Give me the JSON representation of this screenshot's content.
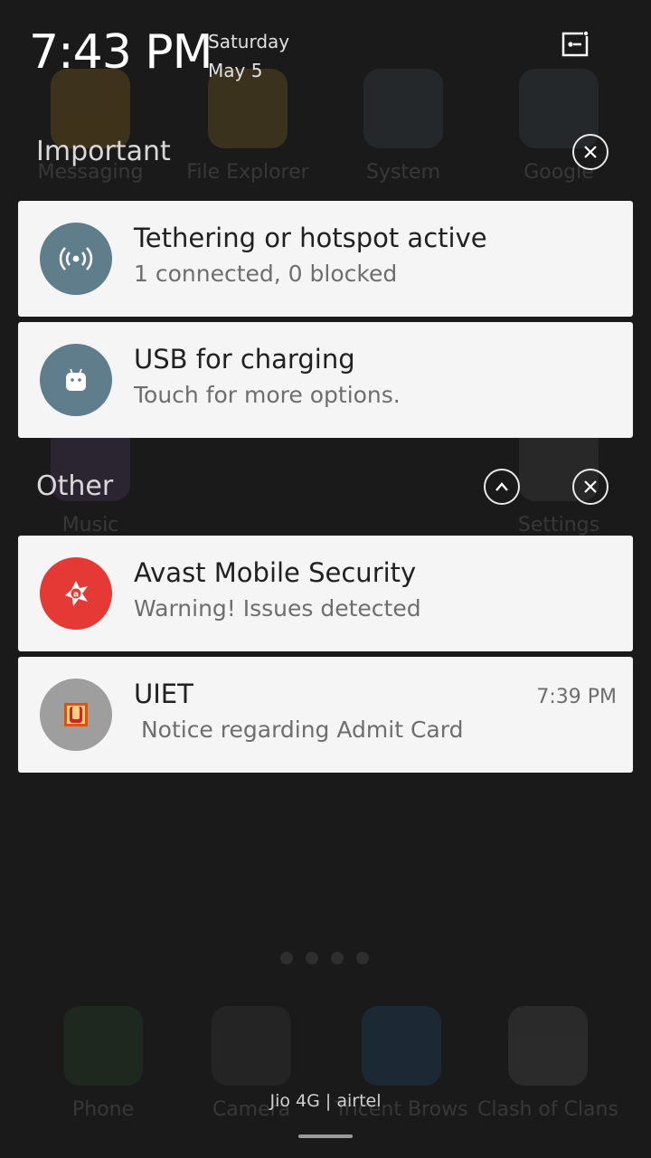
{
  "status": {
    "time": "7:43 PM",
    "day": "Saturday",
    "date": "May 5",
    "edit_icon": "edit-notifications-icon"
  },
  "background_apps": [
    {
      "label": "Messaging",
      "color": "#e0a020"
    },
    {
      "label": "File Explorer",
      "color": "#d0a030"
    },
    {
      "label": "System",
      "color": "#5a6a7a"
    },
    {
      "label": "Google",
      "color": "#5a6a7a"
    },
    {
      "label": "Music",
      "color": "#7a5aa0"
    },
    {
      "label": "Settings",
      "color": "#6a6a6a"
    },
    {
      "label": "Phone",
      "color": "#3a6a3a"
    },
    {
      "label": "Camera",
      "color": "#555555"
    },
    {
      "label": "Tricent Brows",
      "color": "#2a6aaa"
    },
    {
      "label": "Clash of Clans",
      "color": "#777777"
    }
  ],
  "sections": {
    "important": {
      "title": "Important"
    },
    "other": {
      "title": "Other"
    }
  },
  "notifications": [
    {
      "title": "Tethering or hotspot active",
      "subtitle": "1 connected, 0 blocked",
      "icon": "hotspot-icon",
      "color": "#607d8b"
    },
    {
      "title": "USB for charging",
      "subtitle": "Touch for more options.",
      "icon": "android-usb-icon",
      "color": "#607d8b"
    },
    {
      "title": "Avast Mobile Security",
      "subtitle": "Warning! Issues detected",
      "icon": "avast-icon",
      "color": "#e53935"
    },
    {
      "title": "UIET",
      "subtitle": " Notice regarding Admit Card",
      "time": "7:39 PM",
      "icon": "uiet-app-icon",
      "color": "#9e9e9e"
    }
  ],
  "footer": {
    "carrier": "Jio 4G | airtel"
  }
}
